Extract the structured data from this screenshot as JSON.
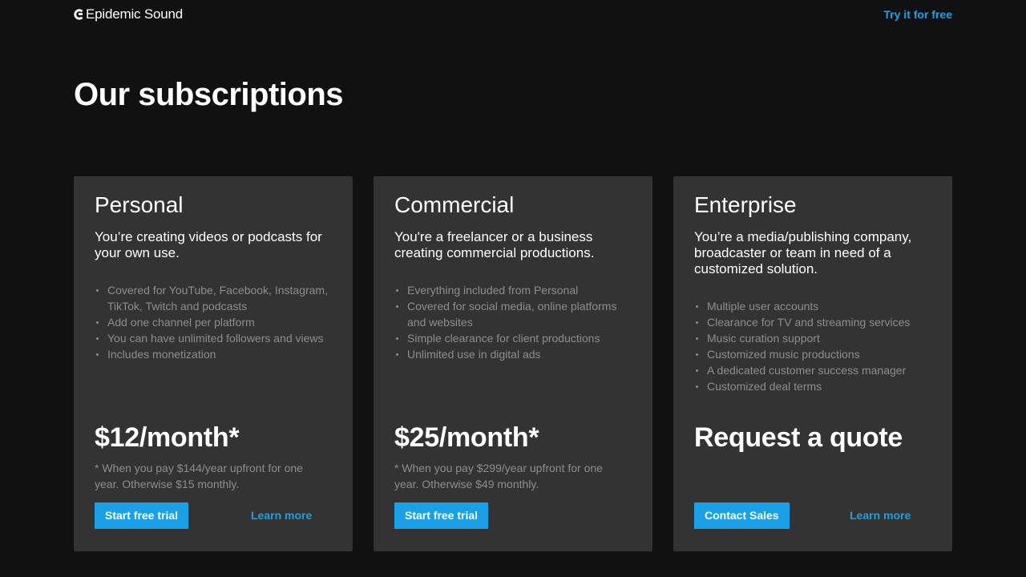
{
  "header": {
    "brand": "Epidemic Sound",
    "try_link": "Try it for free"
  },
  "page": {
    "title": "Our subscriptions"
  },
  "plans": [
    {
      "name": "Personal",
      "description": "You’re creating videos or podcasts for your own use.",
      "features": [
        "Covered for YouTube, Facebook, Instagram, TikTok, Twitch and podcasts",
        "Add one channel per platform",
        "You can have unlimited followers and views",
        "Includes monetization"
      ],
      "price": "$12/month*",
      "price_note": "* When you pay $144/year upfront for one year. Otherwise $15 monthly.",
      "cta": "Start free trial",
      "learn_more": "Learn more"
    },
    {
      "name": "Commercial",
      "description": "You're a freelancer or a business creating commercial productions.",
      "features": [
        "Everything included from Personal",
        "Covered for social media, online platforms and websites",
        "Simple clearance for client productions",
        "Unlimited use in digital ads"
      ],
      "price": "$25/month*",
      "price_note": "* When you pay $299/year upfront for one year. Otherwise $49 monthly.",
      "cta": "Start free trial",
      "learn_more": "Learn more"
    },
    {
      "name": "Enterprise",
      "description": "You’re a media/publishing company, broadcaster or team in need of a customized solution.",
      "features": [
        "Multiple user accounts",
        "Clearance for TV and streaming services",
        "Music curation support",
        "Customized music productions",
        "A dedicated customer success manager",
        "Customized deal terms"
      ],
      "price": "Request a quote",
      "price_note": "",
      "cta": "Contact Sales",
      "learn_more": "Learn more"
    }
  ],
  "colors": {
    "background": "#111111",
    "card": "#333333",
    "accent": "#1aa0e6",
    "muted_text": "#8d8d8d"
  }
}
